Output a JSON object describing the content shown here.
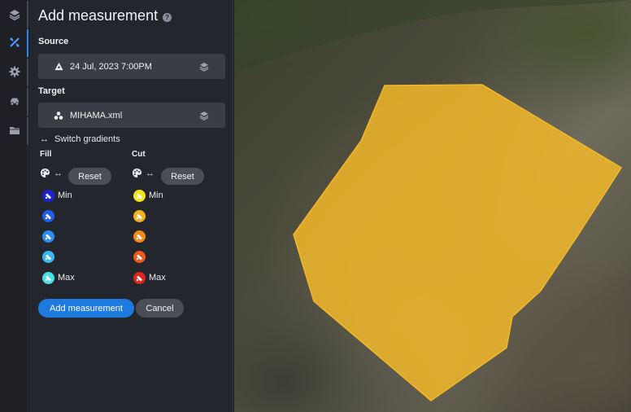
{
  "rail": {
    "items": [
      {
        "icon": "layers-icon"
      },
      {
        "icon": "measure-tools-icon",
        "active": true
      },
      {
        "icon": "gear-icon"
      },
      {
        "icon": "vehicle-icon"
      },
      {
        "icon": "folder-icon"
      }
    ]
  },
  "panel": {
    "title": "Add measurement",
    "help_icon": "?",
    "source": {
      "label": "Source",
      "value": "24 Jul, 2023 7:00PM",
      "lead_icon": "terrain-icon",
      "tail_icon": "layers-icon"
    },
    "target": {
      "label": "Target",
      "value": "MIHAMA.xml",
      "lead_icon": "group-icon",
      "tail_icon": "layers-icon"
    },
    "switch_label": "Switch gradients",
    "fill": {
      "label": "Fill",
      "reset_label": "Reset",
      "swatches": [
        {
          "color": "#1f1fd6",
          "label": "Min"
        },
        {
          "color": "#1f5ef0",
          "label": ""
        },
        {
          "color": "#2a8ff5",
          "label": ""
        },
        {
          "color": "#36b8f2",
          "label": ""
        },
        {
          "color": "#49e0e6",
          "label": "Max"
        }
      ]
    },
    "cut": {
      "label": "Cut",
      "reset_label": "Reset",
      "swatches": [
        {
          "color": "#f5e51b",
          "label": "Min"
        },
        {
          "color": "#f2b21d",
          "label": ""
        },
        {
          "color": "#f08a1d",
          "label": ""
        },
        {
          "color": "#ef5a1c",
          "label": ""
        },
        {
          "color": "#e2251c",
          "label": "Max"
        }
      ]
    },
    "add_button": "Add measurement",
    "cancel_button": "Cancel"
  },
  "viewport": {
    "polygon_color": "#f2b829"
  }
}
